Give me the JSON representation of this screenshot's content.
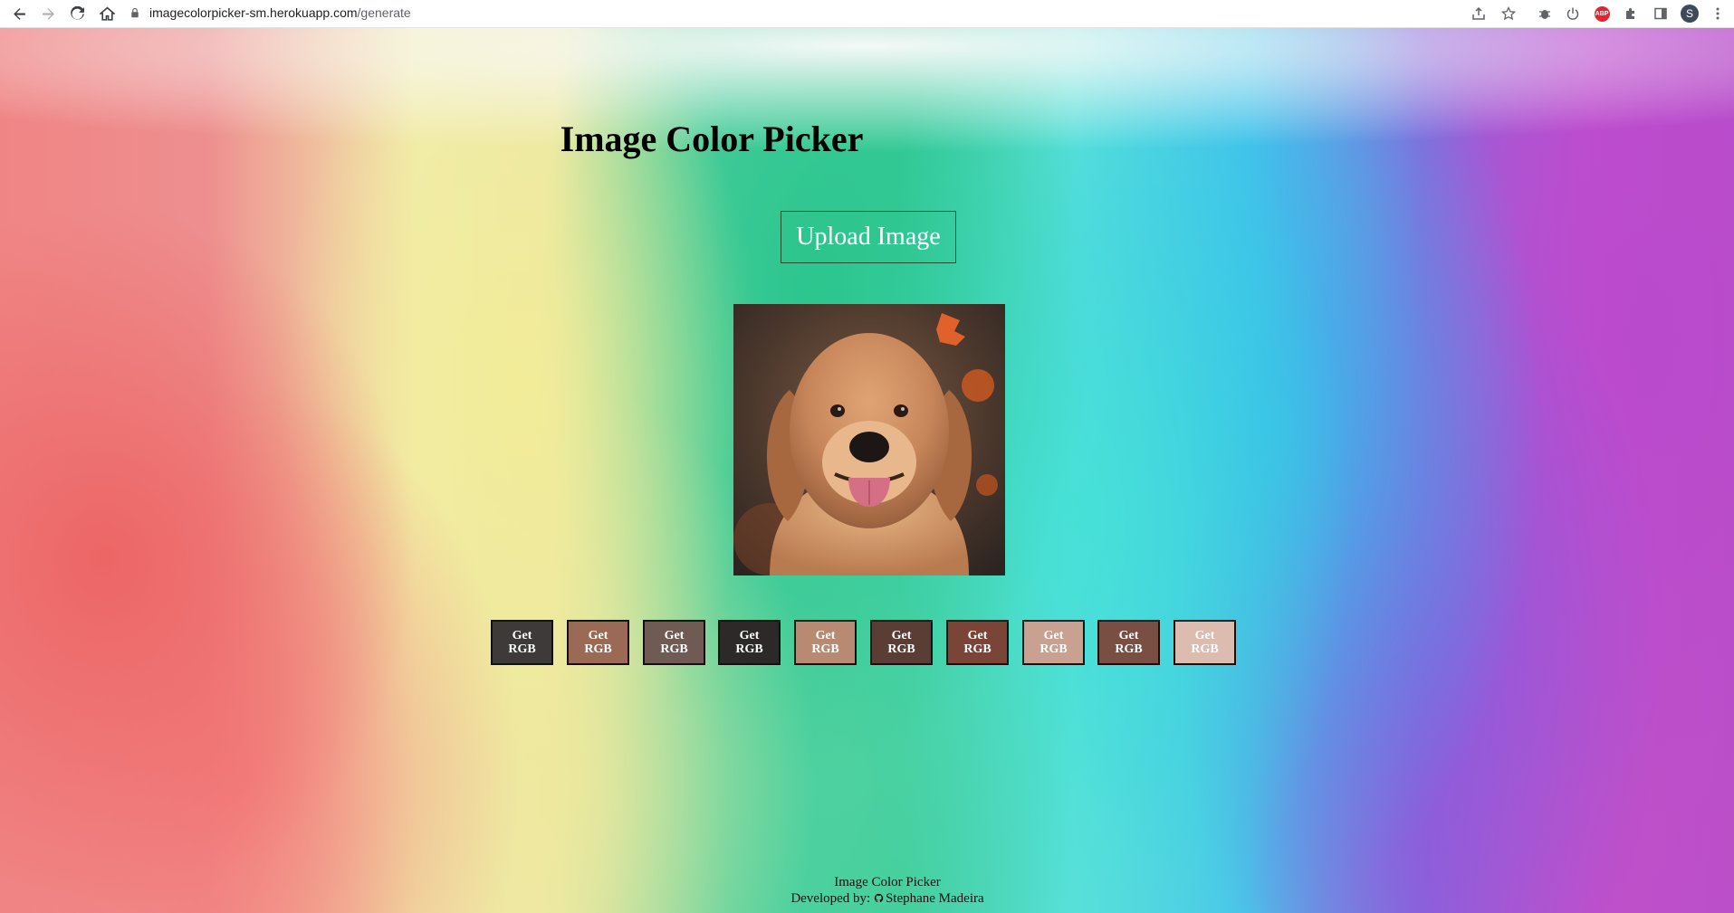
{
  "browser": {
    "url_host": "imagecolorpicker-sm.herokuapp.com",
    "url_path": "/generate",
    "profile_initial": "S",
    "abp_label": "ABP"
  },
  "page": {
    "title": "Image Color Picker",
    "upload_label": "Upload Image",
    "image_alt": "golden retriever dog photo"
  },
  "swatches": [
    {
      "label": "Get RGB",
      "color": "#3d3a39"
    },
    {
      "label": "Get RGB",
      "color": "#9a6a55"
    },
    {
      "label": "Get RGB",
      "color": "#705a54"
    },
    {
      "label": "Get RGB",
      "color": "#2c2928"
    },
    {
      "label": "Get RGB",
      "color": "#b98a72"
    },
    {
      "label": "Get RGB",
      "color": "#5a3d35"
    },
    {
      "label": "Get RGB",
      "color": "#7a4436"
    },
    {
      "label": "Get RGB",
      "color": "#c9a190"
    },
    {
      "label": "Get RGB",
      "color": "#7a4f43"
    },
    {
      "label": "Get RGB",
      "color": "#dcbcae"
    }
  ],
  "footer": {
    "line1": "Image Color Picker",
    "line2_prefix": "Developed by:",
    "author": "Stephane Madeira"
  }
}
